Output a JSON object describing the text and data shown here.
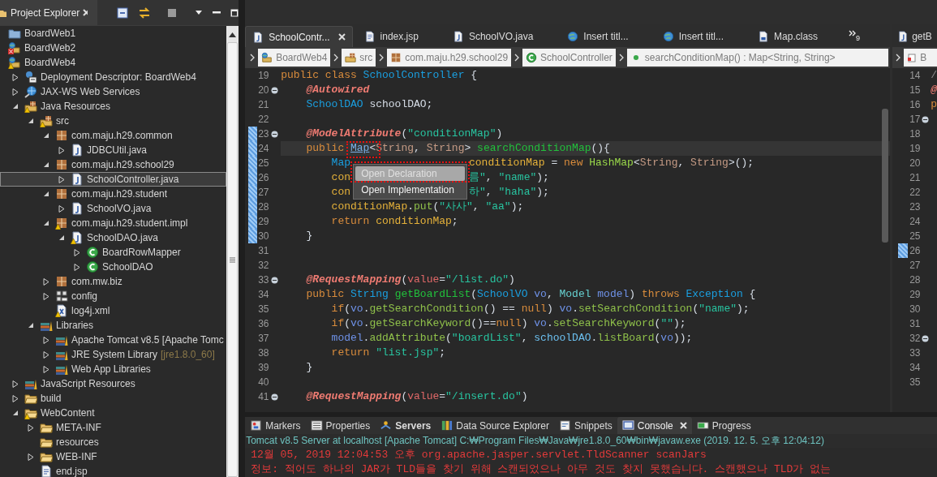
{
  "project_explorer": {
    "title": "Project Explorer",
    "tree": [
      {
        "label": "BoardWeb1",
        "kind": "project_closed",
        "selected": false
      },
      {
        "label": "BoardWeb2",
        "kind": "project",
        "error": true,
        "selected": false
      },
      {
        "label": "BoardWeb4",
        "kind": "project",
        "warning": true,
        "selected": false,
        "children": [
          {
            "label": "Deployment Descriptor: BoardWeb4",
            "kind": "descriptor",
            "expanded": false,
            "selected": false
          },
          {
            "label": "JAX-WS Web Services",
            "kind": "webservice",
            "expanded": false,
            "selected": false
          },
          {
            "label": "Java Resources",
            "kind": "javares",
            "warning": true,
            "expanded": true,
            "selected": false,
            "children": [
              {
                "label": "src",
                "kind": "srcfolder",
                "warning": true,
                "expanded": true,
                "selected": false,
                "children": [
                  {
                    "label": "com.maju.h29.common",
                    "kind": "package",
                    "expanded": true,
                    "selected": false,
                    "children": [
                      {
                        "label": "JDBCUtil.java",
                        "kind": "java",
                        "expanded": false,
                        "selected": false
                      }
                    ]
                  },
                  {
                    "label": "com.maju.h29.school29",
                    "kind": "package",
                    "expanded": true,
                    "selected": false,
                    "children": [
                      {
                        "label": "SchoolController.java",
                        "kind": "java",
                        "expanded": false,
                        "selected": true
                      }
                    ]
                  },
                  {
                    "label": "com.maju.h29.student",
                    "kind": "package",
                    "expanded": true,
                    "selected": false,
                    "children": [
                      {
                        "label": "SchoolVO.java",
                        "kind": "java",
                        "expanded": false,
                        "selected": false
                      }
                    ]
                  },
                  {
                    "label": "com.maju.h29.student.impl",
                    "kind": "package",
                    "warning": true,
                    "expanded": true,
                    "selected": false,
                    "children": [
                      {
                        "label": "SchoolDAO.java",
                        "kind": "java",
                        "warning": true,
                        "expanded": true,
                        "selected": false,
                        "children": [
                          {
                            "label": "BoardRowMapper",
                            "kind": "class",
                            "expanded": false,
                            "selected": false
                          },
                          {
                            "label": "SchoolDAO",
                            "kind": "class",
                            "expanded": false,
                            "selected": false
                          }
                        ]
                      }
                    ]
                  },
                  {
                    "label": "com.mw.biz",
                    "kind": "package",
                    "expanded": false,
                    "selected": false
                  },
                  {
                    "label": "config",
                    "kind": "config",
                    "expanded": false,
                    "selected": false
                  },
                  {
                    "label": "log4j.xml",
                    "kind": "xml",
                    "warning": true,
                    "selected": false
                  }
                ]
              },
              {
                "label": "Libraries",
                "kind": "library",
                "expanded": true,
                "selected": false,
                "children": [
                  {
                    "label": "Apache Tomcat v8.5 [Apache Tomc",
                    "kind": "library",
                    "expanded": false,
                    "selected": false
                  },
                  {
                    "label": "JRE System Library",
                    "decoration": "[jre1.8.0_60]",
                    "kind": "library",
                    "expanded": false,
                    "selected": false
                  },
                  {
                    "label": "Web App Libraries",
                    "kind": "library",
                    "expanded": false,
                    "selected": false
                  }
                ]
              }
            ]
          },
          {
            "label": "JavaScript Resources",
            "kind": "library",
            "expanded": false,
            "selected": false
          },
          {
            "label": "build",
            "kind": "folder",
            "expanded": false,
            "selected": false
          },
          {
            "label": "WebContent",
            "kind": "folder",
            "warning": true,
            "expanded": true,
            "selected": false,
            "children": [
              {
                "label": "META-INF",
                "kind": "folder",
                "expanded": false,
                "selected": false
              },
              {
                "label": "resources",
                "kind": "folder",
                "selected": false
              },
              {
                "label": "WEB-INF",
                "kind": "folder",
                "expanded": false,
                "selected": false
              },
              {
                "label": "end.jsp",
                "kind": "jsp",
                "selected": false
              }
            ]
          }
        ]
      }
    ]
  },
  "editor": {
    "tabs": [
      {
        "label": "SchoolContr...",
        "kind": "java",
        "selected": true
      },
      {
        "label": "index.jsp",
        "kind": "jsp",
        "selected": false
      },
      {
        "label": "SchoolVO.java",
        "kind": "java",
        "selected": false
      },
      {
        "label": "Insert titl...",
        "kind": "web",
        "selected": false
      },
      {
        "label": "Insert titl...",
        "kind": "web",
        "selected": false
      },
      {
        "label": "Map.class",
        "kind": "classfile",
        "selected": false
      }
    ],
    "overflow_count": "9",
    "breadcrumb": [
      {
        "label": "BoardWeb4",
        "kind": "project"
      },
      {
        "label": "src",
        "kind": "srcfolder"
      },
      {
        "label": "com.maju.h29.school29",
        "kind": "package"
      },
      {
        "label": "SchoolController",
        "kind": "class"
      },
      {
        "label": "searchConditionMap() : Map<String, String>",
        "kind": "method"
      }
    ],
    "lines": [
      {
        "n": "19",
        "range": false,
        "current": false,
        "tokens": [
          {
            "kind": "kw",
            "text": "public class "
          },
          {
            "kind": "type",
            "text": "SchoolController"
          },
          {
            "kind": "plain",
            "text": " {"
          }
        ]
      },
      {
        "n": "20",
        "range": false,
        "current": false,
        "folded": false,
        "tokens": [
          {
            "kind": "anno",
            "text": "    @Autowired"
          }
        ]
      },
      {
        "n": "21",
        "range": false,
        "current": false,
        "tokens": [
          {
            "kind": "type",
            "text": "    SchoolDAO"
          },
          {
            "kind": "plain",
            "text": " schoolDAO;"
          }
        ]
      },
      {
        "n": "22",
        "range": false,
        "current": false
      },
      {
        "n": "23",
        "range": true,
        "current": false,
        "folded": false,
        "tokens": [
          {
            "kind": "anno",
            "text": "    @ModelAttribute"
          },
          {
            "kind": "plain",
            "text": "("
          },
          {
            "kind": "str",
            "text": "\"conditionMap\""
          },
          {
            "kind": "plain",
            "text": ")"
          }
        ]
      },
      {
        "n": "24",
        "range": true,
        "current": true,
        "tokens": [
          {
            "kind": "kw",
            "text": "    public "
          },
          {
            "kind": "link",
            "text": "Map"
          },
          {
            "kind": "plain",
            "text": "<"
          },
          {
            "kind": "tparam",
            "text": "String"
          },
          {
            "kind": "plain",
            "text": ", "
          },
          {
            "kind": "tparam",
            "text": "String"
          },
          {
            "kind": "plain",
            "text": "> "
          },
          {
            "kind": "decl",
            "text": "searchConditionMap"
          },
          {
            "kind": "plain",
            "text": "(){"
          }
        ]
      },
      {
        "n": "25",
        "range": true,
        "current": false,
        "tokens": [
          {
            "kind": "type",
            "text": "        Map"
          }
        ],
        "tokens_after_menu": [
          {
            "kind": "field",
            "text": "conditionMap"
          },
          {
            "kind": "plain",
            "text": " = "
          },
          {
            "kind": "kw",
            "text": "new "
          },
          {
            "kind": "lib",
            "text": "HashMap"
          },
          {
            "kind": "plain",
            "text": "<"
          },
          {
            "kind": "tparam",
            "text": "String"
          },
          {
            "kind": "plain",
            "text": ", "
          },
          {
            "kind": "tparam",
            "text": "String"
          },
          {
            "kind": "plain",
            "text": ">();"
          }
        ]
      },
      {
        "n": "26",
        "range": true,
        "current": false,
        "tokens": [
          {
            "kind": "field",
            "text": "        con"
          }
        ],
        "tokens_after_menu": [
          {
            "kind": "str",
            "text": "름\""
          },
          {
            "kind": "plain",
            "text": ", "
          },
          {
            "kind": "str",
            "text": "\"name\""
          },
          {
            "kind": "plain",
            "text": ");"
          }
        ]
      },
      {
        "n": "27",
        "range": true,
        "current": false,
        "tokens": [
          {
            "kind": "field",
            "text": "        con"
          }
        ],
        "tokens_after_menu": [
          {
            "kind": "str",
            "text": "하\""
          },
          {
            "kind": "plain",
            "text": ", "
          },
          {
            "kind": "str",
            "text": "\"haha\""
          },
          {
            "kind": "plain",
            "text": ");"
          }
        ]
      },
      {
        "n": "28",
        "range": true,
        "current": false,
        "tokens": [
          {
            "kind": "field",
            "text": "        conditionMap"
          },
          {
            "kind": "plain",
            "text": "."
          },
          {
            "kind": "method",
            "text": "put"
          },
          {
            "kind": "plain",
            "text": "("
          },
          {
            "kind": "str",
            "text": "\"사사\""
          },
          {
            "kind": "plain",
            "text": ", "
          },
          {
            "kind": "str",
            "text": "\"aa\""
          },
          {
            "kind": "plain",
            "text": ");"
          }
        ]
      },
      {
        "n": "29",
        "range": true,
        "current": false,
        "tokens": [
          {
            "kind": "kw",
            "text": "        return "
          },
          {
            "kind": "field",
            "text": "conditionMap"
          },
          {
            "kind": "plain",
            "text": ";"
          }
        ]
      },
      {
        "n": "30",
        "range": true,
        "current": false,
        "tokens": [
          {
            "kind": "plain",
            "text": "    }"
          }
        ]
      },
      {
        "n": "31",
        "range": false,
        "current": false
      },
      {
        "n": "32",
        "range": false,
        "current": false
      },
      {
        "n": "33",
        "range": false,
        "current": false,
        "folded": false,
        "tokens": [
          {
            "kind": "anno",
            "text": "    @RequestMapping"
          },
          {
            "kind": "plain",
            "text": "("
          },
          {
            "kind": "attr",
            "text": "value"
          },
          {
            "kind": "plain",
            "text": "="
          },
          {
            "kind": "str",
            "text": "\"/list.do\""
          },
          {
            "kind": "plain",
            "text": ")"
          }
        ]
      },
      {
        "n": "34",
        "range": false,
        "current": false,
        "tokens": [
          {
            "kind": "kw",
            "text": "    public "
          },
          {
            "kind": "type",
            "text": "String"
          },
          {
            "kind": "decl",
            "text": " getBoardList"
          },
          {
            "kind": "plain",
            "text": "("
          },
          {
            "kind": "type",
            "text": "SchoolVO"
          },
          {
            "kind": "param",
            "text": " vo"
          },
          {
            "kind": "plain",
            "text": ", "
          },
          {
            "kind": "ltype",
            "text": "Model"
          },
          {
            "kind": "param",
            "text": " model"
          },
          {
            "kind": "plain",
            "text": ") "
          },
          {
            "kind": "kw",
            "text": "throws "
          },
          {
            "kind": "type",
            "text": "Exception"
          },
          {
            "kind": "plain",
            "text": " {"
          }
        ]
      },
      {
        "n": "35",
        "range": false,
        "current": false,
        "tokens": [
          {
            "kind": "kw",
            "text": "        if"
          },
          {
            "kind": "plain",
            "text": "("
          },
          {
            "kind": "param",
            "text": "vo"
          },
          {
            "kind": "plain",
            "text": "."
          },
          {
            "kind": "method",
            "text": "getSearchCondition"
          },
          {
            "kind": "plain",
            "text": "() == "
          },
          {
            "kind": "kw",
            "text": "null"
          },
          {
            "kind": "plain",
            "text": ") "
          },
          {
            "kind": "param",
            "text": "vo"
          },
          {
            "kind": "plain",
            "text": "."
          },
          {
            "kind": "method",
            "text": "setSearchCondition"
          },
          {
            "kind": "plain",
            "text": "("
          },
          {
            "kind": "str",
            "text": "\"name\""
          },
          {
            "kind": "plain",
            "text": ");"
          }
        ]
      },
      {
        "n": "36",
        "range": false,
        "current": false,
        "tokens": [
          {
            "kind": "kw",
            "text": "        if"
          },
          {
            "kind": "plain",
            "text": "("
          },
          {
            "kind": "param",
            "text": "vo"
          },
          {
            "kind": "plain",
            "text": "."
          },
          {
            "kind": "method",
            "text": "getSearchKeyword"
          },
          {
            "kind": "plain",
            "text": "()=="
          },
          {
            "kind": "kw",
            "text": "null"
          },
          {
            "kind": "plain",
            "text": ") "
          },
          {
            "kind": "param",
            "text": "vo"
          },
          {
            "kind": "plain",
            "text": "."
          },
          {
            "kind": "method",
            "text": "setSearchKeyword"
          },
          {
            "kind": "plain",
            "text": "("
          },
          {
            "kind": "str",
            "text": "\"\""
          },
          {
            "kind": "plain",
            "text": ");"
          }
        ]
      },
      {
        "n": "37",
        "range": false,
        "current": false,
        "tokens": [
          {
            "kind": "param",
            "text": "        model"
          },
          {
            "kind": "plain",
            "text": "."
          },
          {
            "kind": "method",
            "text": "addAttribute"
          },
          {
            "kind": "plain",
            "text": "("
          },
          {
            "kind": "str",
            "text": "\"boardList\""
          },
          {
            "kind": "plain",
            "text": ", "
          },
          {
            "kind": "var",
            "text": "schoolDAO"
          },
          {
            "kind": "plain",
            "text": "."
          },
          {
            "kind": "method",
            "text": "listBoard"
          },
          {
            "kind": "plain",
            "text": "("
          },
          {
            "kind": "param",
            "text": "vo"
          },
          {
            "kind": "plain",
            "text": "));"
          }
        ]
      },
      {
        "n": "38",
        "range": false,
        "current": false,
        "tokens": [
          {
            "kind": "kw",
            "text": "        return "
          },
          {
            "kind": "str",
            "text": "\"list.jsp\""
          },
          {
            "kind": "plain",
            "text": ";"
          }
        ]
      },
      {
        "n": "39",
        "range": false,
        "current": false,
        "tokens": [
          {
            "kind": "plain",
            "text": "    }"
          }
        ]
      },
      {
        "n": "40",
        "range": false,
        "current": false
      },
      {
        "n": "41",
        "range": false,
        "current": false,
        "folded": false,
        "tokens": [
          {
            "kind": "anno",
            "text": "    @RequestMapping"
          },
          {
            "kind": "plain",
            "text": "("
          },
          {
            "kind": "attr",
            "text": "value"
          },
          {
            "kind": "plain",
            "text": "="
          },
          {
            "kind": "str",
            "text": "\"/insert.do\""
          },
          {
            "kind": "plain",
            "text": ")"
          }
        ]
      }
    ],
    "context_menu": [
      {
        "label": "Open Declaration",
        "selected": true
      },
      {
        "label": "Open Implementation",
        "selected": false
      }
    ]
  },
  "side_editor": {
    "tab": {
      "label": "getB",
      "kind": "java",
      "selected": false
    },
    "breadcrumb": "B",
    "lines": [
      {
        "n": "14",
        "range": false,
        "text": "/",
        "kind": "comment"
      },
      {
        "n": "15",
        "range": false,
        "text": "@",
        "kind": "anno"
      },
      {
        "n": "16",
        "range": false,
        "text": "p",
        "kind": "kw"
      },
      {
        "n": "17",
        "range": false,
        "folded": false
      },
      {
        "n": "18",
        "range": false
      },
      {
        "n": "19",
        "range": false
      },
      {
        "n": "20",
        "range": false
      },
      {
        "n": "21",
        "range": false
      },
      {
        "n": "22",
        "range": false
      },
      {
        "n": "23",
        "range": false
      },
      {
        "n": "24",
        "range": false
      },
      {
        "n": "25",
        "range": false
      },
      {
        "n": "26",
        "range": true
      },
      {
        "n": "27",
        "range": false
      },
      {
        "n": "28",
        "range": false
      },
      {
        "n": "29",
        "range": false
      },
      {
        "n": "30",
        "range": false
      },
      {
        "n": "31",
        "range": false
      },
      {
        "n": "32",
        "range": false,
        "folded": false
      },
      {
        "n": "33",
        "range": false
      },
      {
        "n": "34",
        "range": false
      },
      {
        "n": "35",
        "range": false
      }
    ]
  },
  "bottom_panel": {
    "tabs": [
      {
        "label": "Markers",
        "kind": "markers",
        "selected": false,
        "bold": false
      },
      {
        "label": "Properties",
        "kind": "properties",
        "selected": false,
        "bold": false
      },
      {
        "label": "Servers",
        "kind": "servers",
        "selected": false,
        "bold": true
      },
      {
        "label": "Data Source Explorer",
        "kind": "datasource",
        "selected": false,
        "bold": false
      },
      {
        "label": "Snippets",
        "kind": "snippets",
        "selected": false,
        "bold": false
      },
      {
        "label": "Console",
        "kind": "console",
        "selected": true,
        "bold": false
      },
      {
        "label": "Progress",
        "kind": "progress",
        "selected": false,
        "bold": false
      }
    ],
    "console_header": "Tomcat v8.5 Server at localhost [Apache Tomcat] C:₩Program Files₩Java₩jre1.8.0_60₩bin₩javaw.exe (2019. 12. 5. 오후 12:04:12)",
    "console_lines": [
      "12월 05, 2019 12:04:53 오후 org.apache.jasper.servlet.TldScanner scanJars",
      "정보: 적어도 하나의 JAR가 TLD들을 찾기 위해 스캔되었으나 아무 것도 찾지 못했습니다. 스캔했으나 TLD가 없는"
    ]
  }
}
